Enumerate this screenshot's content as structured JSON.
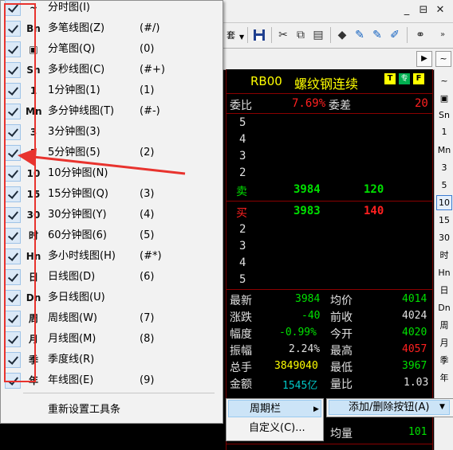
{
  "window": {
    "controls": [
      "_",
      "⊟",
      "✕"
    ]
  },
  "toolbar": {
    "dropdown_label": "套"
  },
  "period_menu": {
    "items": [
      {
        "icon": "~",
        "label": "分时图(I)",
        "key": ""
      },
      {
        "icon": "Bn",
        "label": "多笔线图(Z)",
        "key": "(#/)"
      },
      {
        "icon": "▣",
        "label": "分笔图(Q)",
        "key": "(0)"
      },
      {
        "icon": "Sn",
        "label": "多秒线图(C)",
        "key": "(#+)"
      },
      {
        "icon": "1",
        "label": "1分钟图(1)",
        "key": "(1)"
      },
      {
        "icon": "Mn",
        "label": "多分钟线图(T)",
        "key": "(#-)"
      },
      {
        "icon": "3",
        "label": "3分钟图(3)",
        "key": ""
      },
      {
        "icon": "5",
        "label": "5分钟图(5)",
        "key": "(2)"
      },
      {
        "icon": "10",
        "label": "10分钟图(N)",
        "key": ""
      },
      {
        "icon": "15",
        "label": "15分钟图(Q)",
        "key": "(3)"
      },
      {
        "icon": "30",
        "label": "30分钟图(Y)",
        "key": "(4)"
      },
      {
        "icon": "时",
        "label": "60分钟图(6)",
        "key": "(5)"
      },
      {
        "icon": "Hn",
        "label": "多小时线图(H)",
        "key": "(#*)"
      },
      {
        "icon": "日",
        "label": "日线图(D)",
        "key": "(6)"
      },
      {
        "icon": "Dn",
        "label": "多日线图(U)",
        "key": ""
      },
      {
        "icon": "周",
        "label": "周线图(W)",
        "key": "(7)"
      },
      {
        "icon": "月",
        "label": "月线图(M)",
        "key": "(8)"
      },
      {
        "icon": "季",
        "label": "季度线(R)",
        "key": ""
      },
      {
        "icon": "年",
        "label": "年线图(E)",
        "key": "(9)"
      }
    ],
    "reset_label": "重新设置工具条"
  },
  "quote": {
    "code": "RB00",
    "name": "螺纹钢连续",
    "badges": [
      "T",
      "专",
      "F"
    ],
    "weibi_label": "委比",
    "weibi_value": "7.69%",
    "weicha_label": "委差",
    "weicha_value": "20",
    "ask_levels": [
      "5",
      "4",
      "3",
      "2"
    ],
    "sell_label": "卖",
    "sell_price": "3984",
    "sell_volume": "120",
    "buy_label": "买",
    "buy_price": "3983",
    "buy_volume": "140",
    "bid_levels": [
      "2",
      "3",
      "4",
      "5"
    ],
    "stats": [
      {
        "l1": "最新",
        "v1": "3984",
        "l2": "均价",
        "v2": "4014"
      },
      {
        "l1": "涨跌",
        "v1": "-40",
        "l2": "前收",
        "v2": "4024"
      },
      {
        "l1": "幅度",
        "v1": "-0.99%",
        "l2": "今开",
        "v2": "4020"
      },
      {
        "l1": "振幅",
        "v1": "2.24%",
        "l2": "最高",
        "v2": "4057"
      },
      {
        "l1": "总手",
        "v1": "3849040",
        "l2": "最低",
        "v2": "3967"
      },
      {
        "l1": "金额",
        "v1": "1545亿",
        "l2": "量比",
        "v2": "1.03"
      }
    ],
    "avg_label": "均量",
    "avg_value": "101"
  },
  "right_toolbar": [
    "~",
    "▣",
    "Sn",
    "1",
    "Mn",
    "3",
    "5",
    "10",
    "15",
    "30",
    "时",
    "Hn",
    "日",
    "Dn",
    "周",
    "月",
    "季",
    "年"
  ],
  "context_menu": {
    "period_bar": "周期栏",
    "custom": "自定义(C)...",
    "add_remove": "添加/删除按钮(A)"
  },
  "colors": {
    "up": "#ff2020",
    "down": "#00e000",
    "neutral": "#e0e0e0",
    "label": "#ffff00",
    "annotation": "#e8332e"
  }
}
